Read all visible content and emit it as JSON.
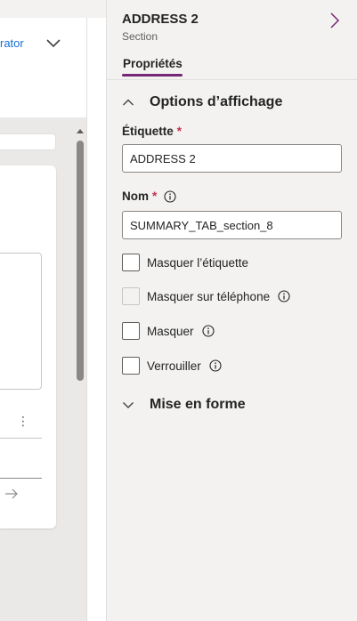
{
  "canvas": {
    "creator_link": "rator"
  },
  "pane": {
    "title": "ADDRESS 2",
    "subtitle": "Section",
    "tab": "Propriétés",
    "sections": {
      "display": "Options d’affichage",
      "format": "Mise en forme"
    },
    "fields": {
      "label": {
        "caption": "Étiquette",
        "required_mark": "*",
        "value": "ADDRESS 2"
      },
      "name": {
        "caption": "Nom",
        "required_mark": "*",
        "value": "SUMMARY_TAB_section_8"
      }
    },
    "checkboxes": [
      {
        "label": "Masquer l’étiquette",
        "checked": false,
        "disabled": false,
        "info": false
      },
      {
        "label": "Masquer sur téléphone",
        "checked": false,
        "disabled": true,
        "info": true
      },
      {
        "label": "Masquer",
        "checked": false,
        "disabled": false,
        "info": true
      },
      {
        "label": "Verrouiller",
        "checked": false,
        "disabled": false,
        "info": true
      }
    ]
  },
  "colors": {
    "accent": "#742774",
    "link": "#1a6fd0",
    "required": "#c4314b"
  },
  "icons": {
    "collapse": "chevron-right-icon",
    "section_expanded": "chevron-up-icon",
    "section_collapsed": "chevron-down-icon",
    "info": "info-icon",
    "more": "more-vertical-icon",
    "next": "arrow-right-icon"
  }
}
